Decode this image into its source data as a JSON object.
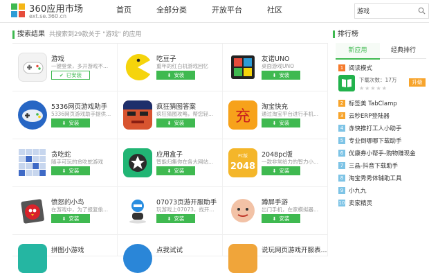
{
  "header": {
    "logo_title": "360应用市场",
    "logo_sub": "ext.se.360.cn",
    "nav": [
      "首页",
      "全部分类",
      "开放平台",
      "社区"
    ],
    "search_value": "游戏"
  },
  "main": {
    "title": "搜索结果",
    "subtitle": "共搜索到29款关于 \"游戏\" 的应用",
    "apps": [
      {
        "name": "游戏",
        "desc": "一键登录，多开游戏不...",
        "button": "已安装",
        "installed": true
      },
      {
        "name": "吃豆子",
        "desc": "重年的红白机游戏回忆",
        "button": "安装",
        "installed": false
      },
      {
        "name": "友诺UNO",
        "desc": "桌面游戏UNO",
        "button": "安装",
        "installed": false
      },
      {
        "name": "5336网页游戏助手",
        "desc": "5336网页游戏助手提供...",
        "button": "安装",
        "installed": false
      },
      {
        "name": "疯狂猜图答案",
        "desc": "疯狂猜图攻略，帮您轻...",
        "button": "安装",
        "installed": false
      },
      {
        "name": "淘宝快充",
        "desc": "通过淘宝平台进行手机...",
        "button": "安装",
        "installed": false
      },
      {
        "name": "贪吃蛇",
        "desc": "随手可玩的贪吃蛇游戏",
        "button": "安装",
        "installed": false
      },
      {
        "name": "应用盒子",
        "desc": "智能归集你在各大网站...",
        "button": "安装",
        "installed": false
      },
      {
        "name": "2048pc版",
        "desc": "一款非常给力的智力小...",
        "button": "安装",
        "installed": false
      },
      {
        "name": "愤怒的小鸟",
        "desc": "在游戏中，为了报复偷...",
        "button": "安装",
        "installed": false
      },
      {
        "name": "07073页游开服助手",
        "desc": "玩游戏上07073，找开...",
        "button": "安装",
        "installed": false
      },
      {
        "name": "蹲屏手游",
        "desc": "出门手机，在家模拟器...",
        "button": "安装",
        "installed": false
      },
      {
        "name": "拼图小游戏",
        "desc": "",
        "button": "",
        "installed": false
      },
      {
        "name": "点我试试",
        "desc": "",
        "button": "",
        "installed": false
      },
      {
        "name": "说玩网页游戏开服表...",
        "desc": "",
        "button": "",
        "installed": false
      }
    ]
  },
  "sidebar": {
    "title": "排行榜",
    "tabs": [
      "新应用",
      "经典排行"
    ],
    "featured": {
      "name": "阅读模式",
      "downloads": "下载次数：17万",
      "stars": "★★★★★",
      "button": "升级"
    },
    "ranks": [
      "标签美 TabClamp",
      "云秒ERP登陆器",
      "赤快推打工人小助手",
      "专业倒哪哪下载助手",
      "优康券小帮手-购物赚现金",
      "三晶-抖音下载助手",
      "淘宝秀秀体辅助工具",
      "小九九",
      "卖家精灵"
    ],
    "rank_numbers": [
      "1",
      "2",
      "3",
      "4",
      "5",
      "6",
      "7",
      "8",
      "9",
      "10"
    ]
  },
  "colors": {
    "accent": "#3fb950",
    "rank_top": "#f57a2c",
    "rank_mid": "#f7a42c",
    "rank_low": "#7ec4e6"
  }
}
